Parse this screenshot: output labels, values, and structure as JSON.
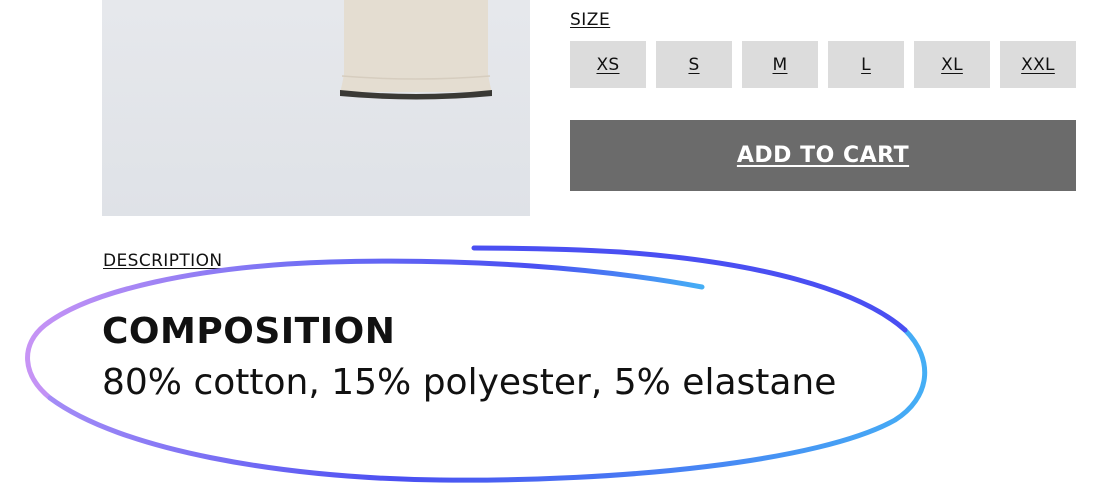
{
  "size": {
    "label": "SIZE",
    "options": [
      "XS",
      "S",
      "M",
      "L",
      "XL",
      "XXL"
    ]
  },
  "cart": {
    "add_label": "ADD TO CART"
  },
  "description": {
    "link_label": "DESCRIPTION"
  },
  "composition": {
    "title": "COMPOSITION",
    "text": "80% cotton, 15% polyester, 5% elastane"
  },
  "colors": {
    "button_bg": "#6b6b6b",
    "size_bg": "#dcdcdc",
    "image_bg": "#e3e5e9",
    "garment": "#e4ddd1",
    "highlight_start": "#c794f5",
    "highlight_mid": "#4a4ff2",
    "highlight_end": "#45aef5"
  }
}
